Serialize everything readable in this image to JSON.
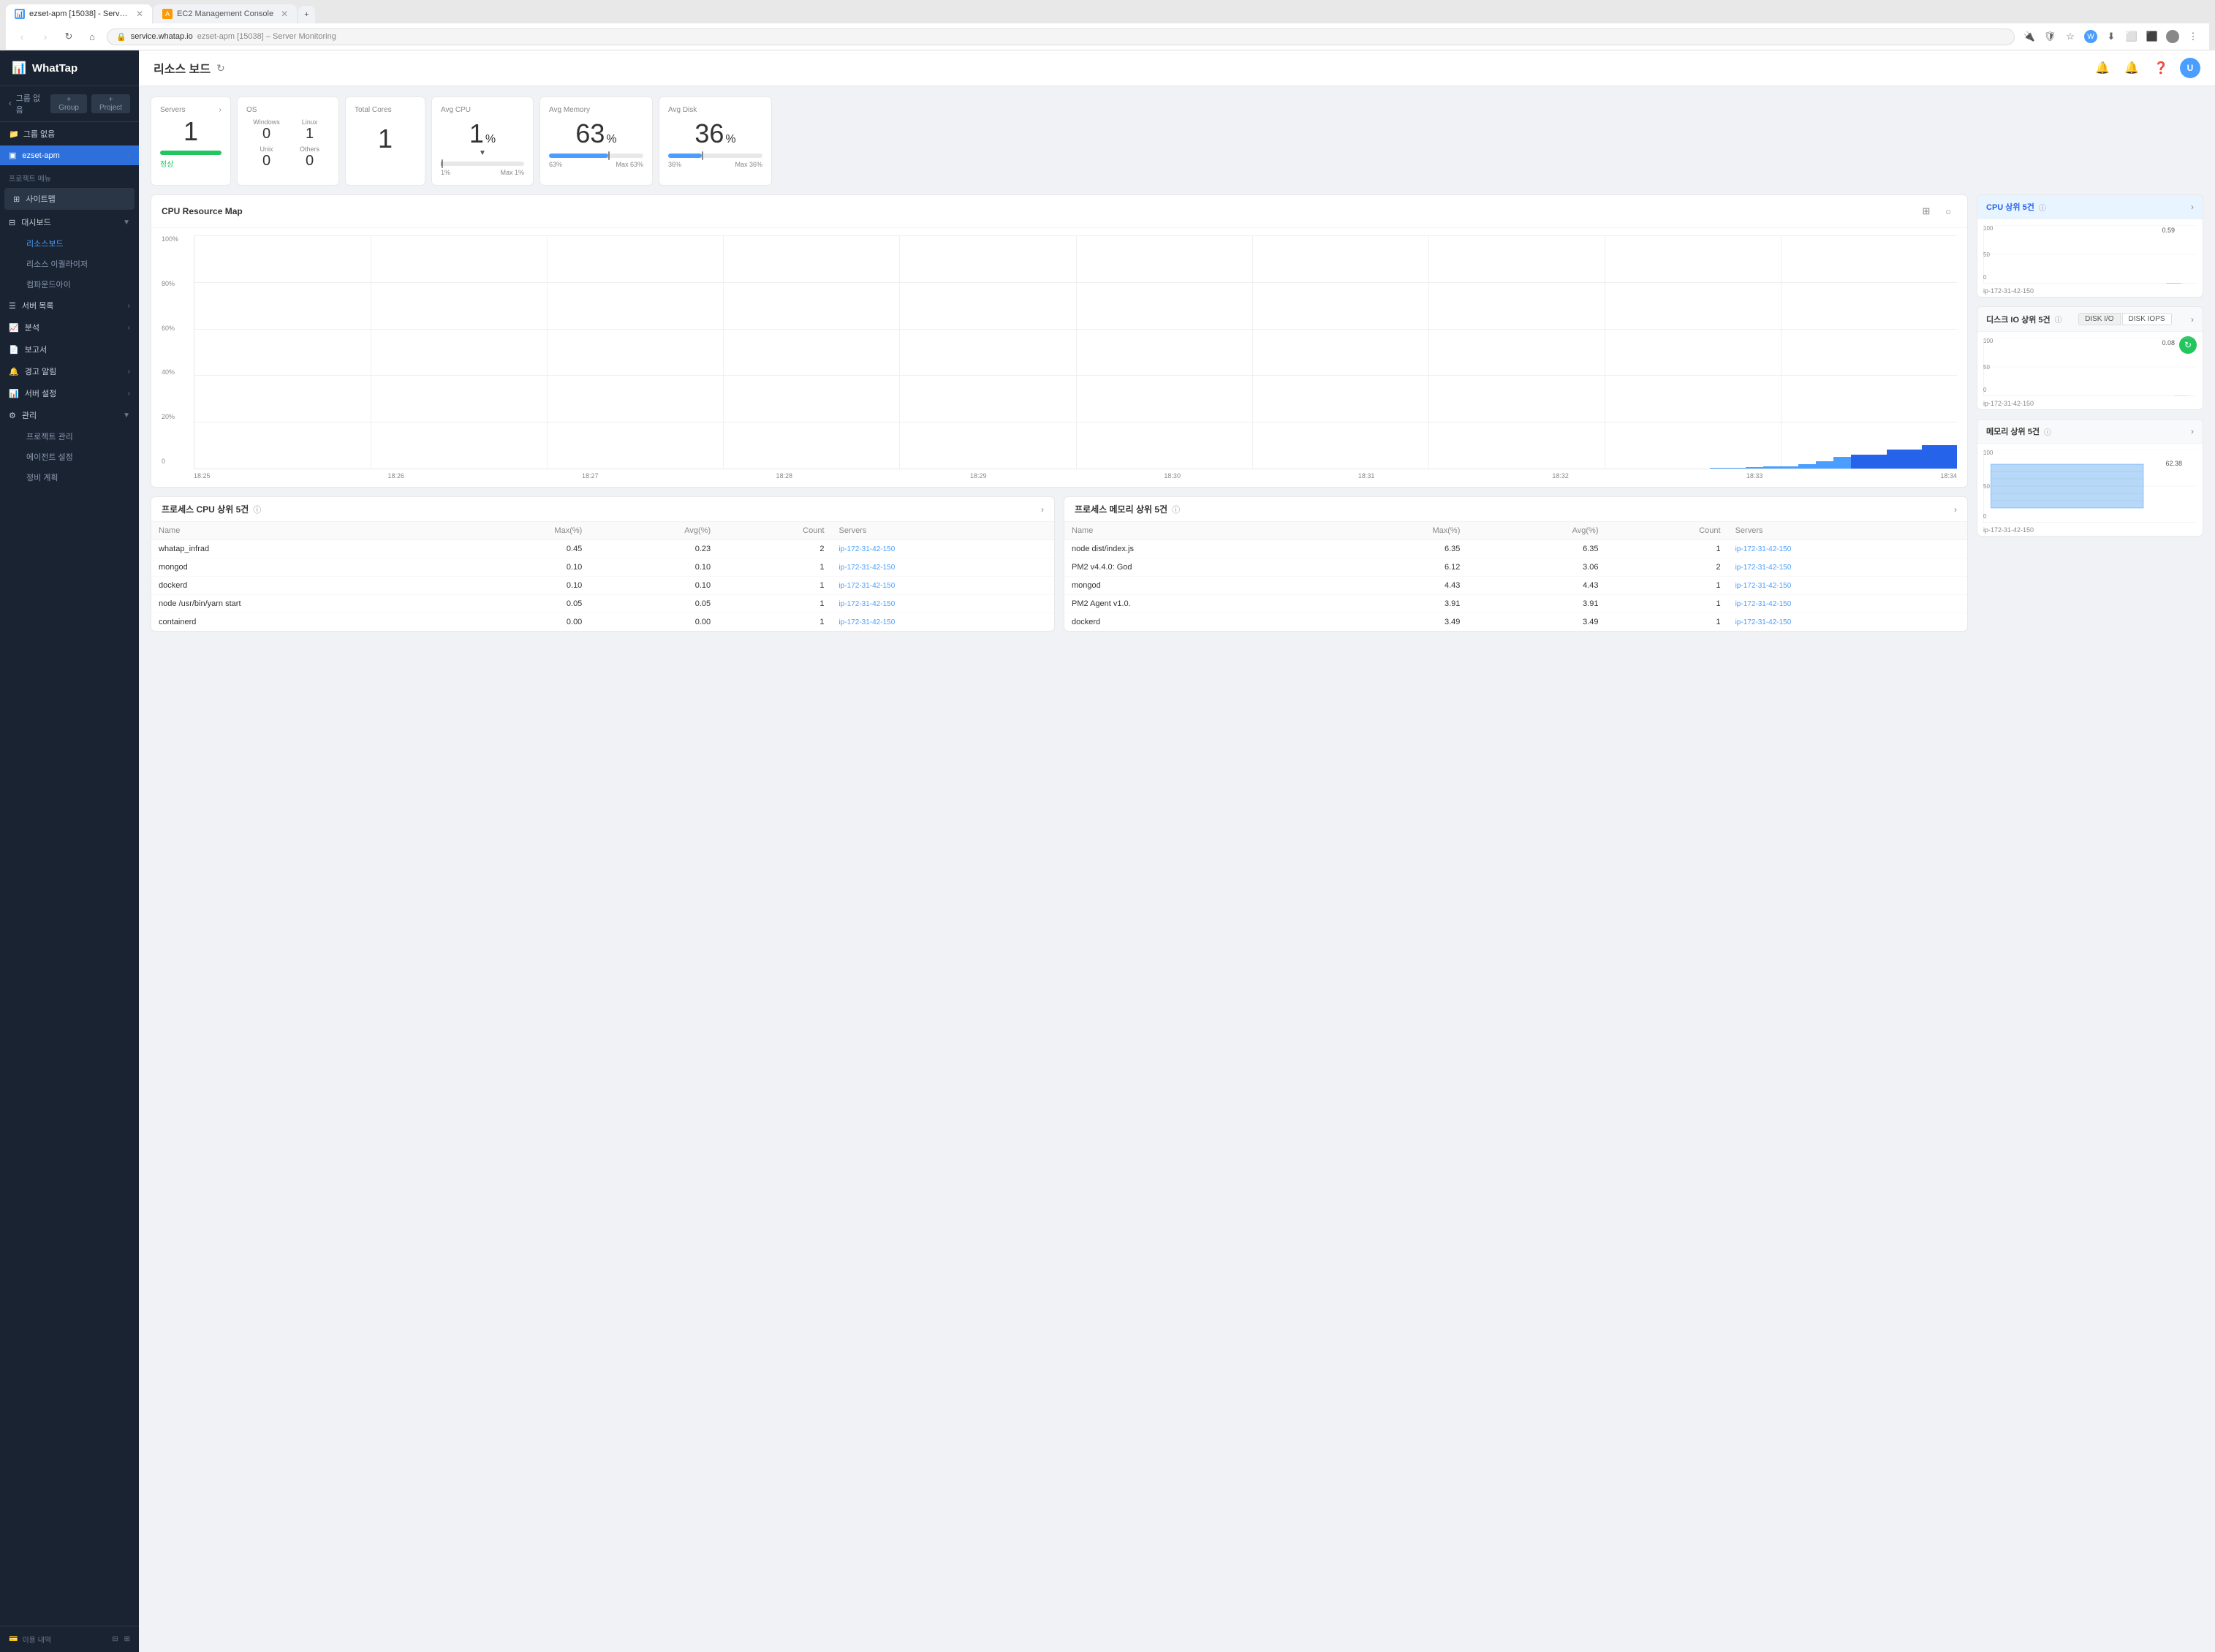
{
  "browser": {
    "tabs": [
      {
        "id": "tab1",
        "label": "ezset-apm [15038] - Server M...",
        "active": true,
        "favicon": "chart"
      },
      {
        "id": "tab2",
        "label": "EC2 Management Console",
        "active": false,
        "favicon": "aws"
      }
    ],
    "url": "service.whatap.io",
    "full_url": "ezset-apm [15038] - Server Monitoring"
  },
  "sidebar": {
    "logo": "WhatTap",
    "logo_icon": "📊",
    "group_label": "그룹 없음",
    "group_btn1": "+ Group",
    "group_btn2": "+ Project",
    "group_item": "그룹 없음",
    "project_item": "ezset-apm",
    "section_label": "프로젝트 메뉴",
    "sitemap": "사이트맵",
    "dashboard_label": "대시보드",
    "menu_items": [
      {
        "id": "resource-board",
        "label": "리소스보드",
        "active": true,
        "indent": 1
      },
      {
        "id": "resource-equalizer",
        "label": "리소스 이퀄라이저",
        "indent": 1
      },
      {
        "id": "compound-eye",
        "label": "컴파운드아이",
        "indent": 1
      }
    ],
    "server_list": "서버 목록",
    "analysis": "분석",
    "report": "보고서",
    "alert": "경고 알림",
    "server_settings": "서버 설정",
    "management": "관리",
    "sub_management": [
      "프로젝트 관리",
      "에이전트 설정",
      "정비 계획"
    ],
    "usage_btn": "이용 내역"
  },
  "header": {
    "title": "리소스 보드",
    "refresh_icon": "↻"
  },
  "stats": {
    "servers": {
      "label": "Servers",
      "value": "1",
      "status_label": "정상",
      "arrow": "›"
    },
    "os": {
      "label": "OS",
      "windows_label": "Windows",
      "linux_label": "Linux",
      "unix_label": "Unix",
      "others_label": "Others",
      "windows_value": "0",
      "linux_value": "1",
      "unix_value": "0",
      "others_value": "0"
    },
    "total_cores": {
      "label": "Total Cores",
      "value": "1"
    },
    "avg_cpu": {
      "label": "Avg CPU",
      "value": "1",
      "unit": "%",
      "min": "1%",
      "max": "Max 1%",
      "arrow": "▼"
    },
    "avg_memory": {
      "label": "Avg Memory",
      "value": "63",
      "unit": "%",
      "min": "63%",
      "max": "Max 63%"
    },
    "avg_disk": {
      "label": "Avg Disk",
      "value": "36",
      "unit": "%",
      "min": "36%",
      "max": "Max 36%"
    }
  },
  "cpu_map": {
    "title": "CPU Resource Map",
    "y_labels": [
      "100%",
      "80%",
      "60%",
      "40%",
      "20%",
      "0"
    ],
    "x_labels": [
      "18:25",
      "18:26",
      "18:27",
      "18:28",
      "18:29",
      "18:30",
      "18:31",
      "18:32",
      "18:33",
      "18:34"
    ],
    "bar_data": [
      0,
      0,
      0,
      0,
      0,
      0,
      0,
      0,
      1,
      8
    ]
  },
  "cpu_top5": {
    "title": "CPU 상위 5건",
    "info_icon": "ⓘ",
    "expand": "›",
    "chart_label": "0.59",
    "server_label": "ip-172-31-42-150",
    "y_max": 100
  },
  "disk_io": {
    "title": "디스크 IO 상위 5건",
    "info_icon": "ⓘ",
    "toggle1": "DISK I/O",
    "toggle2": "DISK IOPS",
    "expand": "›",
    "chart_label": "0.08",
    "server_label": "ip-172-31-42-150",
    "refresh_icon": "↻"
  },
  "memory_top5": {
    "title": "메모리 상위 5건",
    "info_icon": "ⓘ",
    "expand": "›",
    "chart_label": "62.38",
    "server_label": "ip-172-31-42-150",
    "y_max": 100
  },
  "process_cpu": {
    "title": "프로세스 CPU 상위 5건",
    "info_icon": "ⓘ",
    "expand": "›",
    "columns": [
      "Name",
      "Max(%)",
      "Avg(%)",
      "Count",
      "Servers"
    ],
    "rows": [
      {
        "name": "whatap_infrad",
        "max": "0.45",
        "avg": "0.23",
        "count": "2",
        "servers": "ip-172-31-42-150"
      },
      {
        "name": "mongod",
        "max": "0.10",
        "avg": "0.10",
        "count": "1",
        "servers": "ip-172-31-42-150"
      },
      {
        "name": "dockerd",
        "max": "0.10",
        "avg": "0.10",
        "count": "1",
        "servers": "ip-172-31-42-150"
      },
      {
        "name": "node /usr/bin/yarn start",
        "max": "0.05",
        "avg": "0.05",
        "count": "1",
        "servers": "ip-172-31-42-150"
      },
      {
        "name": "containerd",
        "max": "0.00",
        "avg": "0.00",
        "count": "1",
        "servers": "ip-172-31-42-150"
      }
    ]
  },
  "process_memory": {
    "title": "프로세스 메모리 상위 5건",
    "info_icon": "ⓘ",
    "expand": "›",
    "columns": [
      "Name",
      "Max(%)",
      "Avg(%)",
      "Count",
      "Servers"
    ],
    "rows": [
      {
        "name": "node dist/index.js",
        "max": "6.35",
        "avg": "6.35",
        "count": "1",
        "servers": "ip-172-31-42-150"
      },
      {
        "name": "PM2 v4.4.0: God",
        "max": "6.12",
        "avg": "3.06",
        "count": "2",
        "servers": "ip-172-31-42-150"
      },
      {
        "name": "mongod",
        "max": "4.43",
        "avg": "4.43",
        "count": "1",
        "servers": "ip-172-31-42-150"
      },
      {
        "name": "PM2 Agent v1.0.",
        "max": "3.91",
        "avg": "3.91",
        "count": "1",
        "servers": "ip-172-31-42-150"
      },
      {
        "name": "dockerd",
        "max": "3.49",
        "avg": "3.49",
        "count": "1",
        "servers": "ip-172-31-42-150"
      }
    ]
  },
  "icons": {
    "chart": "📊",
    "bell": "🔔",
    "question": "❓",
    "settings": "⚙",
    "grid": "⊞",
    "circle": "○",
    "expand": "›",
    "collapse": "‹",
    "refresh": "↻",
    "arrow_down": "▼",
    "folder": "📁",
    "list": "≡",
    "dashboard": "▣",
    "server": "🖥",
    "analysis": "📈",
    "report": "📄",
    "alert": "🔔",
    "gear": "⚙",
    "wrench": "🔧",
    "card": "💳",
    "minimize": "⊟",
    "maximize": "⊞",
    "back": "‹",
    "forward": "›",
    "reload": "↻",
    "home": "⌂",
    "lock": "🔒",
    "star": "☆",
    "download": "⬇",
    "screenshot": "⬜",
    "menu": "⋮"
  }
}
